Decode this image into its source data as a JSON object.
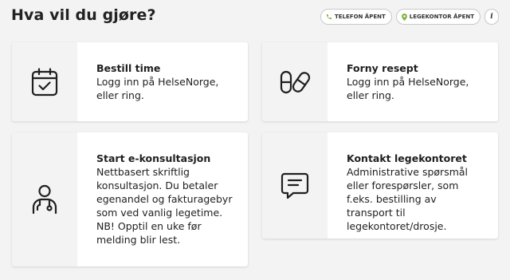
{
  "header": {
    "title": "Hva vil du gjøre?",
    "badges": [
      {
        "label": "TELEFON ÅPENT",
        "icon": "phone-icon"
      },
      {
        "label": "LEGEKONTOR ÅPENT",
        "icon": "location-pin-icon"
      }
    ],
    "info_icon": "i"
  },
  "colors": {
    "status_open": "#7ab33a",
    "icon_stroke": "#1f1f1f",
    "icon_area_bg": "#f3f3f3"
  },
  "cards": [
    {
      "title": "Bestill time",
      "text": "Logg inn på HelseNorge, eller ring.",
      "icon": "calendar-check-icon"
    },
    {
      "title": "Forny resept",
      "text": "Logg inn på HelseNorge, eller ring.",
      "icon": "pills-icon"
    },
    {
      "title": "Start e-konsultasjon",
      "text": "Nettbasert skriftlig konsultasjon. Du betaler egenandel og fakturagebyr som ved vanlig legetime. NB! Opptil en uke før melding blir lest.",
      "icon": "doctor-icon"
    },
    {
      "title": "Kontakt legekontoret",
      "text": "Administrative spørsmål eller forespørsler, som f.eks. bestilling av transport til legekontoret/drosje.",
      "icon": "message-icon"
    }
  ]
}
